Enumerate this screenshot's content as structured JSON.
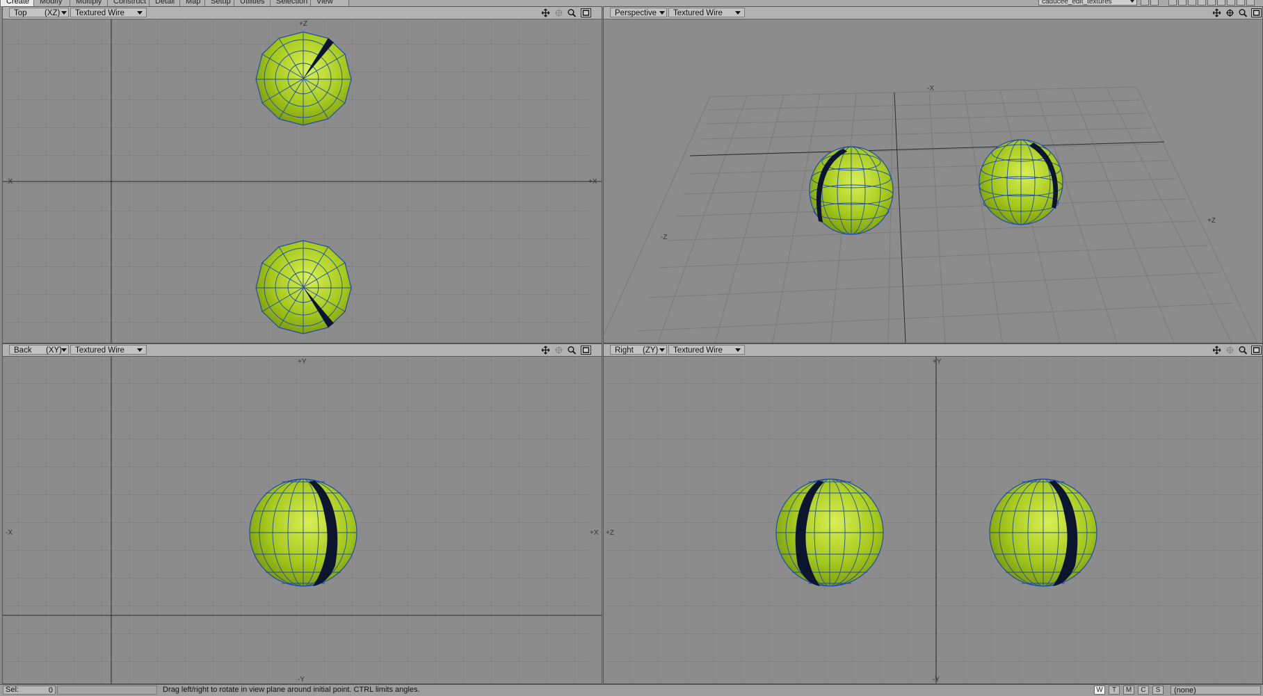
{
  "menu": {
    "tabs": [
      "Create",
      "Modify",
      "Multiply",
      "Construct",
      "Detail",
      "Map",
      "Setup",
      "Utilities",
      "Selection",
      "View"
    ],
    "active": "Create",
    "object": "caducee_edit_textures"
  },
  "viewports": {
    "top": {
      "view": "Top",
      "axes": "(XZ)",
      "mode": "Textured Wire",
      "labels": {
        "left": "-X",
        "right": "+X",
        "top": "+Z"
      }
    },
    "perspective": {
      "view": "Perspective",
      "mode": "Textured Wire",
      "labels": {
        "x": "-X",
        "z": "-Z",
        "z2": "+Z"
      }
    },
    "back": {
      "view": "Back",
      "axes": "(XY)",
      "mode": "Textured Wire",
      "labels": {
        "top": "+Y",
        "bottom": "-Y",
        "left": "-X",
        "right": "+X"
      }
    },
    "right": {
      "view": "Right",
      "axes": "(ZY)",
      "mode": "Textured Wire",
      "labels": {
        "top": "+Y",
        "bottom": "-Y",
        "left": "+Z"
      }
    }
  },
  "status": {
    "sel_label": "Sel:",
    "sel_count": "0",
    "hint": "Drag left/right to rotate in view plane around initial point. CTRL limits angles.",
    "modes": [
      "W",
      "T",
      "M",
      "C",
      "S"
    ],
    "active_mode": "W",
    "surface": "(none)"
  },
  "colors": {
    "sphere": "#9fc21a",
    "wire": "#1d4bb0",
    "grid": "#7a7a7a",
    "axis": "#2a2a2a",
    "background": "#8c8c8c"
  }
}
